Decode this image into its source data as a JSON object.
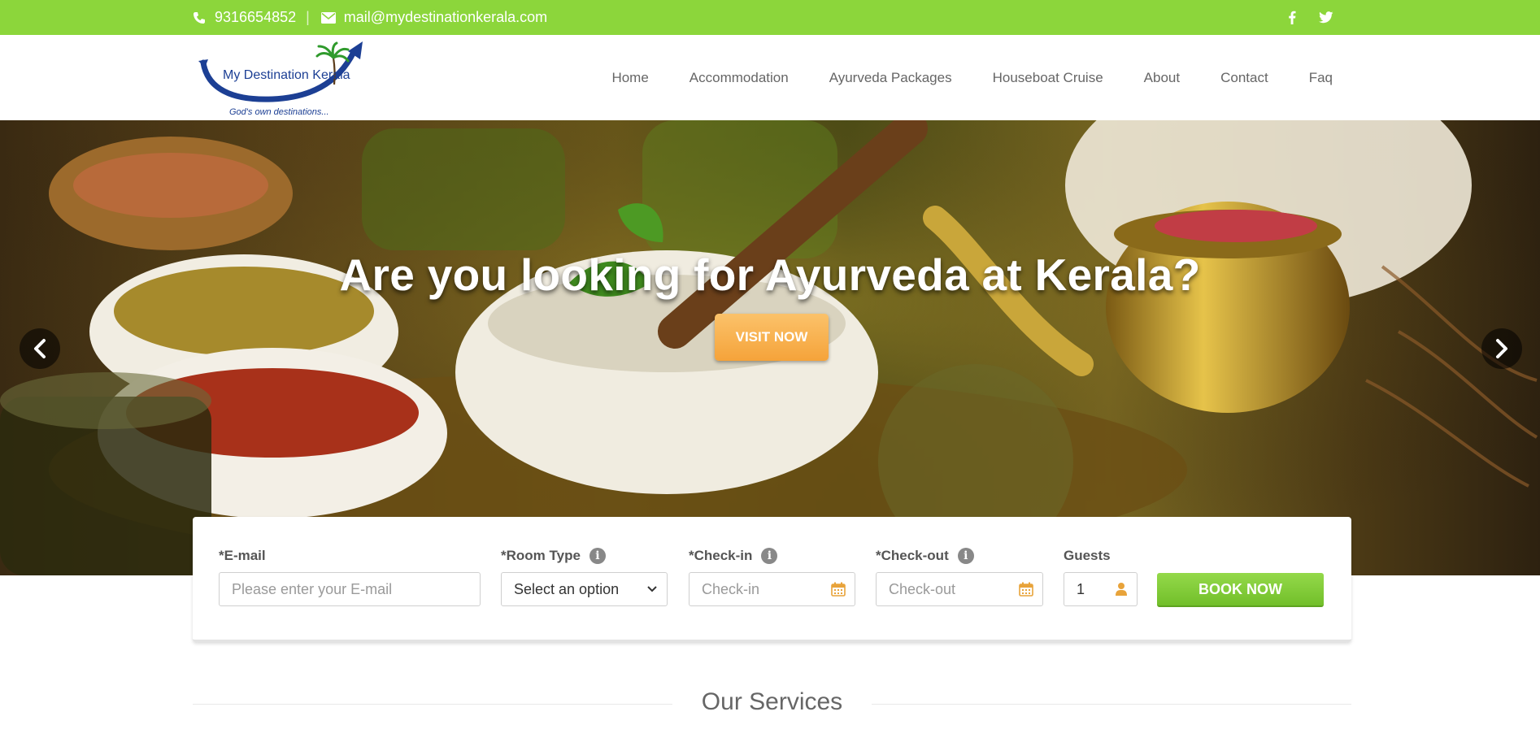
{
  "topbar": {
    "phone": "9316654852",
    "separator": "|",
    "email": "mail@mydestinationkerala.com",
    "social": [
      "facebook-icon",
      "twitter-icon"
    ],
    "bg_color": "#8cd63b"
  },
  "logo": {
    "name": "My Destination Kerala",
    "tagline": "God's own destinations..."
  },
  "nav": {
    "items": [
      "Home",
      "Accommodation",
      "Ayurveda Packages",
      "Houseboat Cruise",
      "About",
      "Contact",
      "Faq"
    ]
  },
  "hero": {
    "title": "Are you looking for Ayurveda at Kerala?",
    "button": "VISIT NOW",
    "prev_icon": "chevron-left-icon",
    "next_icon": "chevron-right-icon",
    "button_color": "#f5a33a"
  },
  "booking": {
    "email_label": "*E-mail",
    "email_placeholder": "Please enter your E-mail",
    "room_label": "*Room Type",
    "room_value": "Select an option",
    "checkin_label": "*Check-in",
    "checkin_placeholder": "Check-in",
    "checkout_label": "*Check-out",
    "checkout_placeholder": "Check-out",
    "guests_label": "Guests",
    "guests_value": "1",
    "book_button": "BOOK NOW",
    "accent_color": "#7ac532"
  },
  "services": {
    "title": "Our Services"
  }
}
